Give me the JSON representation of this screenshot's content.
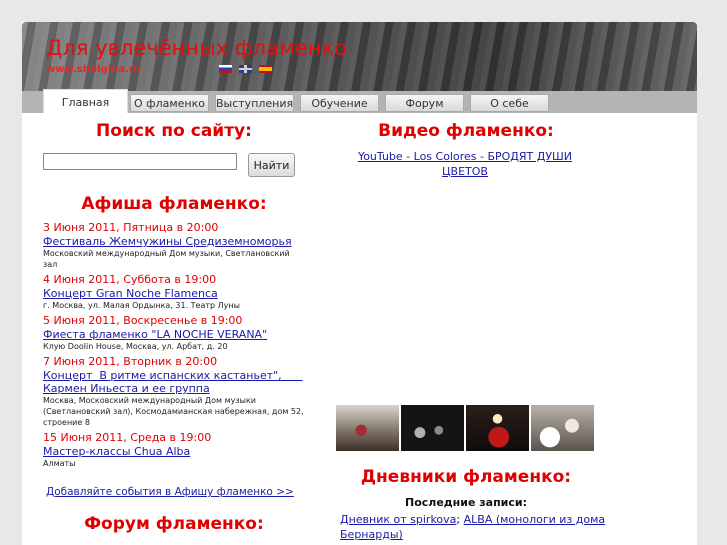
{
  "header": {
    "site_title": "Для увлечённых фламенко",
    "site_url": "www.shulgina.ru",
    "flags": [
      "ru",
      "en",
      "es"
    ]
  },
  "nav": {
    "tabs": [
      {
        "label": "Главная",
        "active": true
      },
      {
        "label": "О фламенко",
        "active": false
      },
      {
        "label": "Выступления",
        "active": false
      },
      {
        "label": "Обучение",
        "active": false
      },
      {
        "label": "Форум",
        "active": false
      },
      {
        "label": "О себе",
        "active": false
      }
    ]
  },
  "search": {
    "heading": "Поиск по сайту:",
    "value": "",
    "button_label": "Найти"
  },
  "afisha": {
    "heading": "Афиша фламенко:",
    "events": [
      {
        "date": "3 Июня 2011, Пятница в 20:00",
        "title": "Фестиваль Жемчужины Средиземноморья",
        "place": "Московский международный Дом музыки, Светлановский зал"
      },
      {
        "date": "4 Июня 2011, Суббота в 19:00",
        "title": "Концерт Gran Noche Flamenca",
        "place": "г. Москва, ул. Малая Ордынка, 31. Театр Луны"
      },
      {
        "date": "5 Июня 2011, Воскресенье в 19:00",
        "title": "Фиеста фламенко \"LA NOCHE VERANA\"",
        "place": "Клую Doolin House, Москва, ул. Арбат, д. 20"
      },
      {
        "date": "7 Июня 2011, Вторник в 20:00",
        "title": "Концерт  В ритме испанских кастаньет\",      \nКармен Иньеста и ее группа",
        "place": "Москва, Московский международный Дом музыки (Светлановский зал), Космодамианская набережная, дом 52, строение 8"
      },
      {
        "date": "15 Июня 2011, Среда в 19:00",
        "title": "Мастер-классы Chua Alba",
        "place": "Алматы"
      }
    ],
    "add_link": "Добавляйте события в Афишу фламенко >>"
  },
  "forum": {
    "heading": "Форум фламенко:"
  },
  "video": {
    "heading": "Видео фламенко:",
    "link": "YouTube - Los Colores - БРОДЯТ ДУШИ ЦВЕТОВ"
  },
  "diaries": {
    "heading": "Дневники фламенко:",
    "subheading": "Последние записи:",
    "entry_author": "Дневник от spirkova",
    "separator": ";",
    "entry_title": "ALBA (монологи из дома Бернарды)"
  }
}
